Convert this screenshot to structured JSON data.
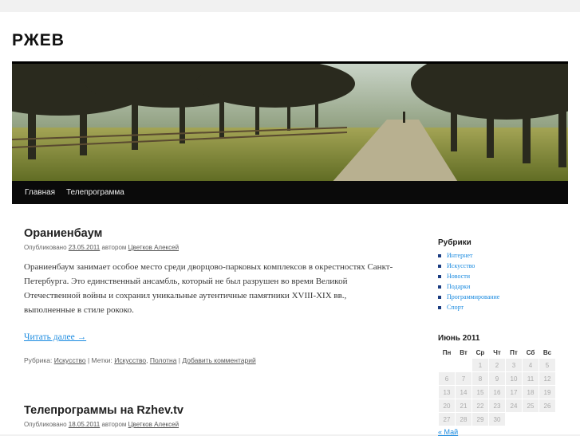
{
  "site": {
    "title": "РЖЕВ"
  },
  "nav": {
    "items": [
      "Главная",
      "Телепрограмма"
    ]
  },
  "posts": [
    {
      "title": "Ораниенбаум",
      "meta_prefix": "Опубликовано",
      "date": "23.05.2011",
      "author_prefix": "автором",
      "author": "Цветков Алексей",
      "excerpt": "Ораниенбаум занимает особое место среди дворцово-парковых комплексов в окрестностях Санкт-Петербурга. Это единственный ансамбль, который не был разрушен во время Великой Отечественной войны и сохранил уникальные аутентичные памятники XVIII-XIX вв., выполненные в стиле рококо.",
      "read_more": "Читать далее →",
      "rubric_label": "Рубрика:",
      "rubric": "Искусство",
      "tags_label": "Метки:",
      "tag1": "Искусство",
      "tag2": "Полотна",
      "comment": "Добавить комментарий"
    },
    {
      "title": "Телепрограммы на Rzhev.tv",
      "meta_prefix": "Опубликовано",
      "date": "18.05.2011",
      "author_prefix": "автором",
      "author": "Цветков Алексей"
    }
  ],
  "sidebar": {
    "categories_title": "Рубрики",
    "categories": [
      "Интернет",
      "Искусство",
      "Новости",
      "Подарки",
      "Программирование",
      "Спорт"
    ],
    "calendar_title": "Июнь 2011",
    "weekdays": [
      "Пн",
      "Вт",
      "Ср",
      "Чт",
      "Пт",
      "Сб",
      "Вс"
    ],
    "weeks": [
      [
        "",
        "",
        "1",
        "2",
        "3",
        "4",
        "5"
      ],
      [
        "6",
        "7",
        "8",
        "9",
        "10",
        "11",
        "12"
      ],
      [
        "13",
        "14",
        "15",
        "16",
        "17",
        "18",
        "19"
      ],
      [
        "20",
        "21",
        "22",
        "23",
        "24",
        "25",
        "26"
      ],
      [
        "27",
        "28",
        "29",
        "30",
        "",
        "",
        ""
      ]
    ],
    "prev_link": "« Май"
  },
  "colors": {
    "link": "#1b8be0",
    "nav_bg": "#0a0a0a"
  }
}
